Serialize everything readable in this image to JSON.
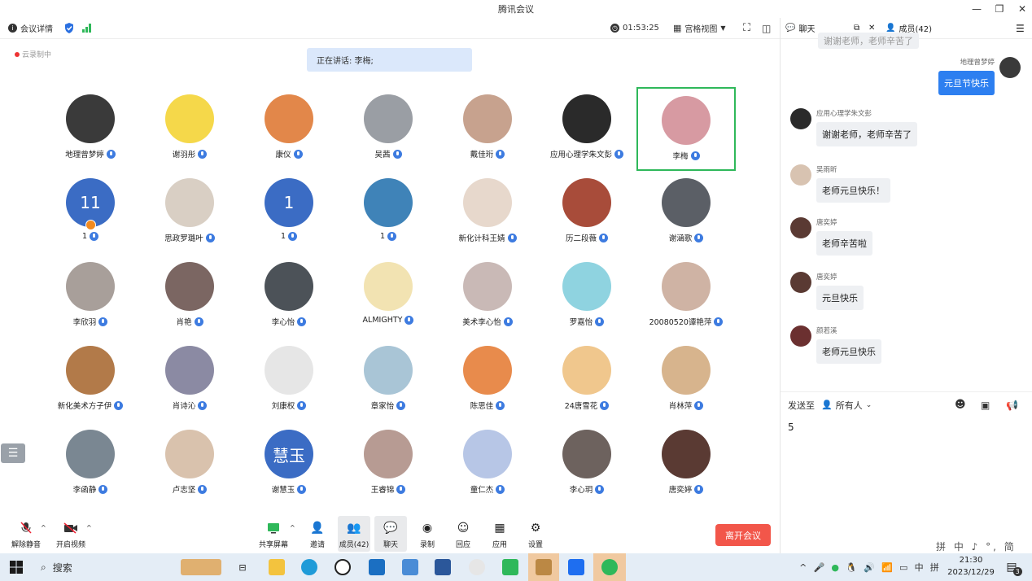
{
  "window": {
    "title": "腾讯会议",
    "min": "—",
    "max": "❐",
    "close": "✕"
  },
  "toolbar": {
    "meeting_info": "会议详情",
    "timer": "01:53:25",
    "view_mode": "宫格视图"
  },
  "recording_label": "云录制中",
  "speaking_banner": "正在讲话: 李梅;",
  "participants": [
    {
      "name": "地理曾梦婷",
      "color": "#3a3a3a"
    },
    {
      "name": "谢羽彤",
      "color": "#f5d84a"
    },
    {
      "name": "康仪",
      "color": "#e2874a"
    },
    {
      "name": "吴茜",
      "color": "#9a9ea4"
    },
    {
      "name": "戴佳珩",
      "color": "#c7a28e"
    },
    {
      "name": "应用心理学朱文彭",
      "color": "#2a2a2a"
    },
    {
      "name": "李梅",
      "color": "#d79aa2",
      "active": true
    },
    {
      "name": "1",
      "color": "#3b6cc4",
      "letter": "1",
      "host": true
    },
    {
      "name": "思政罗璐叶",
      "color": "#d9cfc4"
    },
    {
      "name": "1",
      "color": "#3b6cc4",
      "letter": "1"
    },
    {
      "name": "1",
      "color": "#3f83b8"
    },
    {
      "name": "新化计科王婧",
      "color": "#e7d8cc"
    },
    {
      "name": "历二段薇",
      "color": "#a84c3a"
    },
    {
      "name": "谢涵歌",
      "color": "#5b5f66"
    },
    {
      "name": "李欣羽",
      "color": "#a89f9a"
    },
    {
      "name": "肖艳",
      "color": "#7b6662"
    },
    {
      "name": "李心怡",
      "color": "#4c5258"
    },
    {
      "name": "ALMIGHTY",
      "color": "#f2e3b2"
    },
    {
      "name": "美术李心怡",
      "color": "#c9b9b6"
    },
    {
      "name": "罗嘉怡",
      "color": "#8fd3e0"
    },
    {
      "name": "20080520谭艳萍",
      "color": "#cfb3a4"
    },
    {
      "name": "新化美术方子伊",
      "color": "#b27a49"
    },
    {
      "name": "肖诗沁",
      "color": "#8b8aa3"
    },
    {
      "name": "刘康权",
      "color": "#e6e6e6"
    },
    {
      "name": "章家怡",
      "color": "#a9c5d6"
    },
    {
      "name": "陈思佳",
      "color": "#e88b4c"
    },
    {
      "name": "24唐雪花",
      "color": "#f0c78d"
    },
    {
      "name": "肖林萍",
      "color": "#d7b48d"
    },
    {
      "name": "李函静",
      "color": "#7a8792"
    },
    {
      "name": "卢志坚",
      "color": "#d9c2ad"
    },
    {
      "name": "谢慧玉",
      "color": "#3b6cc4",
      "letter": "慧玉"
    },
    {
      "name": "王睿锦",
      "color": "#b79b93"
    },
    {
      "name": "童仁杰",
      "color": "#b7c6e6"
    },
    {
      "name": "李心玥",
      "color": "#6d625e"
    },
    {
      "name": "唐奕婷",
      "color": "#5a3a33"
    }
  ],
  "bottom": {
    "unmute": "解除静音",
    "start_video": "开启视频",
    "share": "共享屏幕",
    "invite": "邀请",
    "members": "成员(42)",
    "chat": "聊天",
    "record": "录制",
    "replay": "回应",
    "apps": "应用",
    "settings": "设置",
    "leave": "离开会议"
  },
  "chat": {
    "tab_chat": "聊天",
    "tab_members": "成员(42)",
    "top_partial": "谢谢老师，老师辛苦了",
    "messages": [
      {
        "sender": "地理曾梦婷",
        "text": "元旦节快乐",
        "mine": true,
        "color": "#3a3a3a"
      },
      {
        "sender": "应用心理学朱文彭",
        "text": "谢谢老师，老师辛苦了",
        "color": "#2a2a2a"
      },
      {
        "sender": "吴雨昕",
        "text": "老师元旦快乐！",
        "color": "#d8c3b1"
      },
      {
        "sender": "唐奕婷",
        "text": "老师辛苦啦",
        "color": "#5a3a33"
      },
      {
        "sender": "唐奕婷",
        "text": "元旦快乐",
        "color": "#5a3a33"
      },
      {
        "sender": "颜若溪",
        "text": "老师元旦快乐",
        "color": "#6b3030"
      }
    ],
    "send_to_label": "发送至",
    "send_to_target": "所有人",
    "input_value": "5"
  },
  "taskbar": {
    "search": "搜索",
    "time": "21:30",
    "date": "2023/12/29",
    "lang": "中",
    "notif": "3",
    "ime": "拼 中 ♪ °, 简 ⚙"
  }
}
